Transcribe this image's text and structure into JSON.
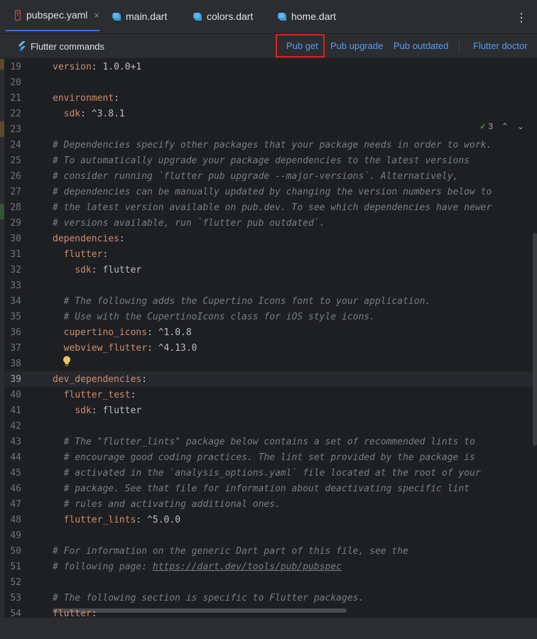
{
  "tabs": [
    {
      "label": "pubspec.yaml",
      "icon": "yaml-file-icon",
      "active": true,
      "close": "×"
    },
    {
      "label": "main.dart",
      "icon": "dart-file-icon"
    },
    {
      "label": "colors.dart",
      "icon": "dart-file-icon"
    },
    {
      "label": "home.dart",
      "icon": "dart-file-icon"
    }
  ],
  "tab_icon_letter": "Y",
  "more_menu": "⋮",
  "flutter_commands": {
    "title": "Flutter commands",
    "pub_get": "Pub get",
    "pub_upgrade": "Pub upgrade",
    "pub_outdated": "Pub outdated",
    "flutter_doctor": "Flutter doctor"
  },
  "inspections": {
    "count": "3",
    "check": "✓",
    "up": "⌃",
    "down": "⌄"
  },
  "colors": {
    "accent": "#3574f0",
    "link": "#589df6",
    "highlight_box": "#e0201a",
    "keyword": "#cf8e6d",
    "comment": "#7a7e85"
  },
  "current_line": "39",
  "lines": [
    {
      "n": "19",
      "parts": [
        {
          "t": "version",
          "k": 1
        },
        {
          "t": ": 1.0.0+1"
        }
      ]
    },
    {
      "n": "20",
      "parts": []
    },
    {
      "n": "21",
      "parts": [
        {
          "t": "environment",
          "k": 1
        },
        {
          "t": ":"
        }
      ]
    },
    {
      "n": "22",
      "parts": [
        {
          "t": "  "
        },
        {
          "t": "sdk",
          "k": 1
        },
        {
          "t": ": ^3.8.1"
        }
      ]
    },
    {
      "n": "23",
      "parts": []
    },
    {
      "n": "24",
      "parts": [
        {
          "t": "# Dependencies specify other packages that your package needs in order to work.",
          "c": 1
        }
      ]
    },
    {
      "n": "25",
      "parts": [
        {
          "t": "# To automatically upgrade your package dependencies to the latest versions",
          "c": 1
        }
      ]
    },
    {
      "n": "26",
      "parts": [
        {
          "t": "# consider running `flutter pub upgrade --major-versions`. Alternatively,",
          "c": 1
        }
      ]
    },
    {
      "n": "27",
      "parts": [
        {
          "t": "# dependencies can be manually updated by changing the version numbers below to",
          "c": 1
        }
      ]
    },
    {
      "n": "28",
      "parts": [
        {
          "t": "# the latest version available on pub.dev. To see which dependencies have newer",
          "c": 1
        }
      ]
    },
    {
      "n": "29",
      "parts": [
        {
          "t": "# versions available, run `flutter pub outdated`.",
          "c": 1
        }
      ]
    },
    {
      "n": "30",
      "parts": [
        {
          "t": "dependencies",
          "k": 1
        },
        {
          "t": ":"
        }
      ]
    },
    {
      "n": "31",
      "parts": [
        {
          "t": "  "
        },
        {
          "t": "flutter",
          "k": 1
        },
        {
          "t": ":"
        }
      ]
    },
    {
      "n": "32",
      "parts": [
        {
          "t": "    "
        },
        {
          "t": "sdk",
          "k": 1
        },
        {
          "t": ": flutter"
        }
      ]
    },
    {
      "n": "33",
      "parts": []
    },
    {
      "n": "34",
      "parts": [
        {
          "t": "  "
        },
        {
          "t": "# The following adds the Cupertino Icons font to your application.",
          "c": 1
        }
      ]
    },
    {
      "n": "35",
      "parts": [
        {
          "t": "  "
        },
        {
          "t": "# Use with the CupertinoIcons class for iOS style icons.",
          "c": 1
        }
      ]
    },
    {
      "n": "36",
      "parts": [
        {
          "t": "  "
        },
        {
          "t": "cupertino_icons",
          "k": 1
        },
        {
          "t": ": ^1.0.8"
        }
      ]
    },
    {
      "n": "37",
      "parts": [
        {
          "t": "  "
        },
        {
          "t": "webview_flutter",
          "k": 1
        },
        {
          "t": ": ^4.13.0"
        }
      ]
    },
    {
      "n": "38",
      "parts": []
    },
    {
      "n": "39",
      "parts": [
        {
          "t": "dev_dependencies",
          "k": 1
        },
        {
          "t": ":"
        }
      ]
    },
    {
      "n": "40",
      "parts": [
        {
          "t": "  "
        },
        {
          "t": "flutter_test",
          "k": 1
        },
        {
          "t": ":"
        }
      ]
    },
    {
      "n": "41",
      "parts": [
        {
          "t": "    "
        },
        {
          "t": "sdk",
          "k": 1
        },
        {
          "t": ": flutter"
        }
      ]
    },
    {
      "n": "42",
      "parts": []
    },
    {
      "n": "43",
      "parts": [
        {
          "t": "  "
        },
        {
          "t": "# The \"flutter_lints\" package below contains a set of recommended lints to",
          "c": 1
        }
      ]
    },
    {
      "n": "44",
      "parts": [
        {
          "t": "  "
        },
        {
          "t": "# encourage good coding practices. The lint set provided by the package is",
          "c": 1
        }
      ]
    },
    {
      "n": "45",
      "parts": [
        {
          "t": "  "
        },
        {
          "t": "# activated in the `analysis_options.yaml` file located at the root of your",
          "c": 1
        }
      ]
    },
    {
      "n": "46",
      "parts": [
        {
          "t": "  "
        },
        {
          "t": "# package. See that file for information about deactivating specific lint",
          "c": 1
        }
      ]
    },
    {
      "n": "47",
      "parts": [
        {
          "t": "  "
        },
        {
          "t": "# rules and activating additional ones.",
          "c": 1
        }
      ]
    },
    {
      "n": "48",
      "parts": [
        {
          "t": "  "
        },
        {
          "t": "flutter_lints",
          "k": 1
        },
        {
          "t": ": ^5.0.0"
        }
      ]
    },
    {
      "n": "49",
      "parts": []
    },
    {
      "n": "50",
      "parts": [
        {
          "t": "# For information on the generic Dart part of this file, see the",
          "c": 1
        }
      ]
    },
    {
      "n": "51",
      "parts": [
        {
          "t": "# following page: ",
          "c": 1
        },
        {
          "t": "https://dart.dev/tools/pub/pubspec",
          "c": 1,
          "u": 1
        }
      ]
    },
    {
      "n": "52",
      "parts": []
    },
    {
      "n": "53",
      "parts": [
        {
          "t": "# The following section is specific to Flutter packages.",
          "c": 1
        }
      ]
    },
    {
      "n": "54",
      "parts": [
        {
          "t": "flutter",
          "k": 1
        },
        {
          "t": ":"
        }
      ]
    }
  ]
}
